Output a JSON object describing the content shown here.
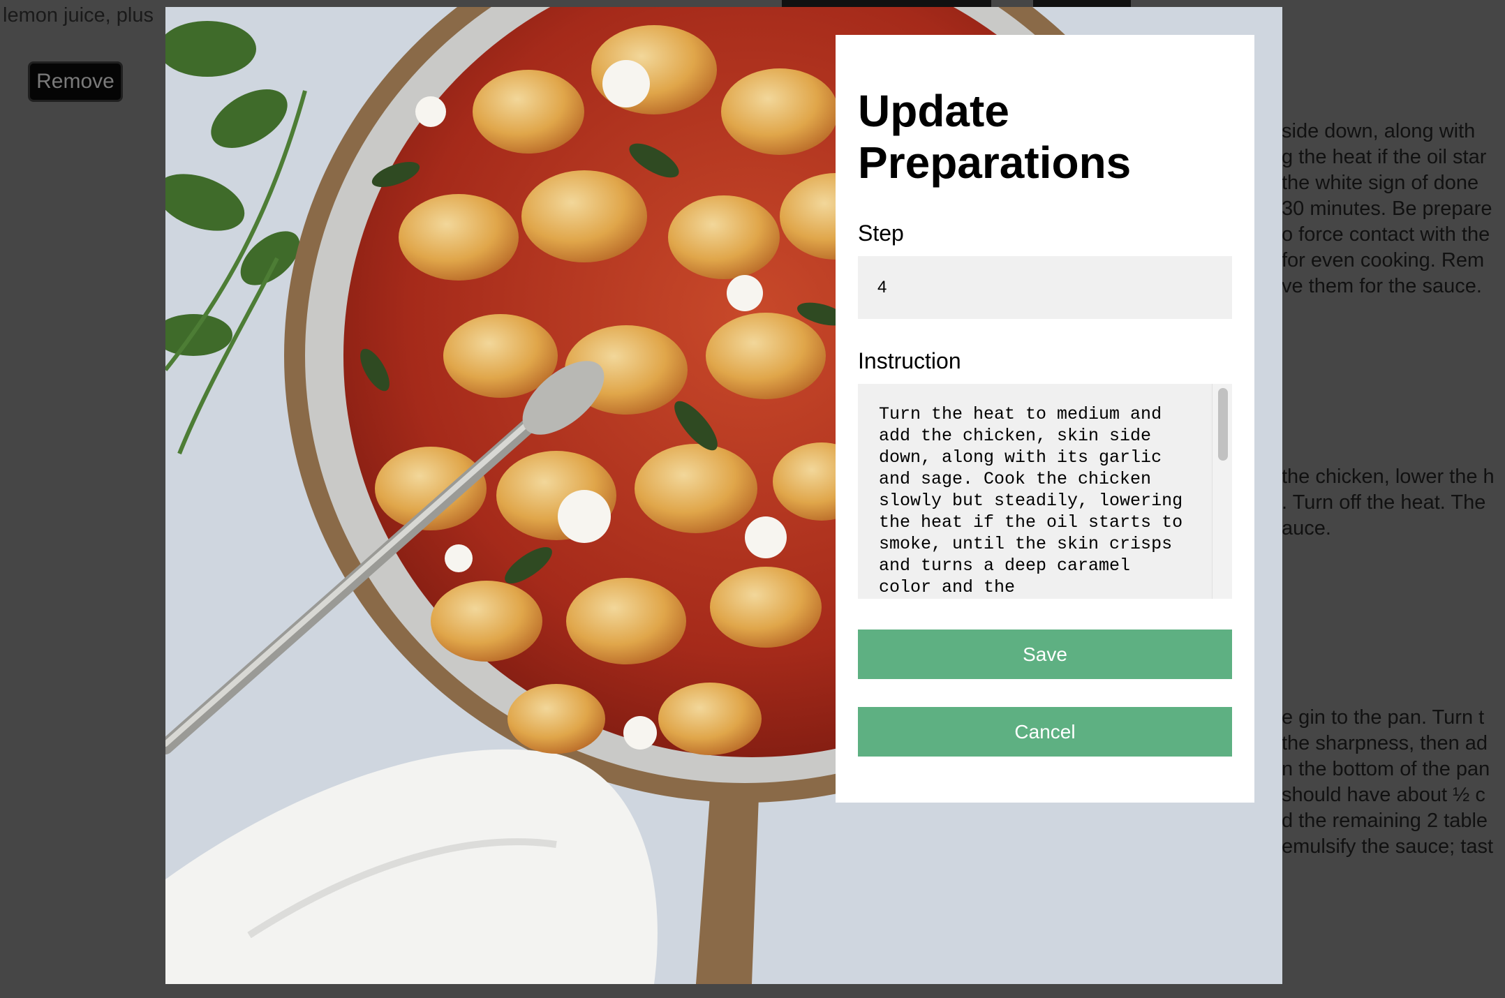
{
  "background": {
    "snippet": "lemon juice, plus",
    "remove_label": "Remove",
    "paragraphs": [
      "side down, along with\ng the heat if the oil star\nthe white sign of done\n30 minutes. Be prepare\no force contact with the\nfor even cooking. Rem\nve them for the sauce.",
      "the chicken, lower the h\n. Turn off the heat. The\nauce.",
      "e gin to the pan. Turn t\nthe sharpness, then ad\nn the bottom of the pan\nshould have about ½ c\nd the remaining 2 table\nemulsify the sauce; tast"
    ]
  },
  "modal": {
    "title": "Update Preparations",
    "step_label": "Step",
    "step_value": "4",
    "instruction_label": "Instruction",
    "instruction_value": "Turn the heat to medium and add the chicken, skin side down, along with its garlic and sage. Cook the chicken slowly but steadily, lowering the heat if the oil starts to smoke, until the skin crisps and turns a deep caramel color and the",
    "save_label": "Save",
    "cancel_label": "Cancel"
  },
  "colors": {
    "overlay": "#464646",
    "button": "#5eb082",
    "input_bg": "#f0f0f0"
  }
}
